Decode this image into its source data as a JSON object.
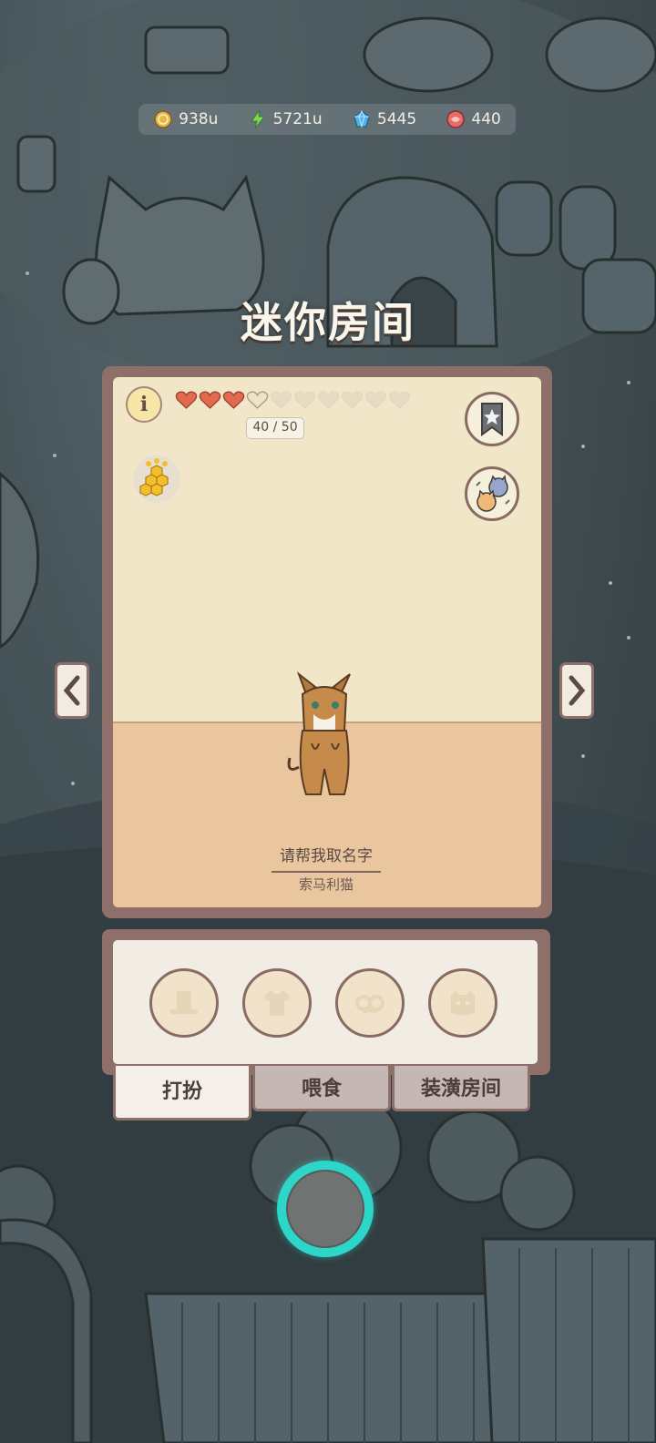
{
  "currencies": [
    {
      "icon": "coin-icon",
      "value": "938u",
      "color": "#e8b74a"
    },
    {
      "icon": "lightning-icon",
      "value": "5721u",
      "color": "#7ed957"
    },
    {
      "icon": "gem-icon",
      "value": "5445",
      "color": "#4fb2e8"
    },
    {
      "icon": "candy-icon",
      "value": "440",
      "color": "#e86a6a"
    }
  ],
  "page_title": "迷你房间",
  "hearts": {
    "filled": 3,
    "total": 10,
    "label": "40 / 50"
  },
  "info_label": "i",
  "pet": {
    "name_prompt": "请帮我取名字",
    "breed": "索马利猫"
  },
  "wardrobe_slots": [
    {
      "icon": "hat-icon"
    },
    {
      "icon": "shirt-icon"
    },
    {
      "icon": "glasses-icon"
    },
    {
      "icon": "face-accessory-icon"
    }
  ],
  "tabs": [
    {
      "label": "打扮",
      "active": true
    },
    {
      "label": "喂食",
      "active": false
    },
    {
      "label": "装潢房间",
      "active": false
    }
  ],
  "colors": {
    "accent": "#2cd6c9",
    "frame": "#8e6f6a",
    "heart": "#e26a4e"
  }
}
